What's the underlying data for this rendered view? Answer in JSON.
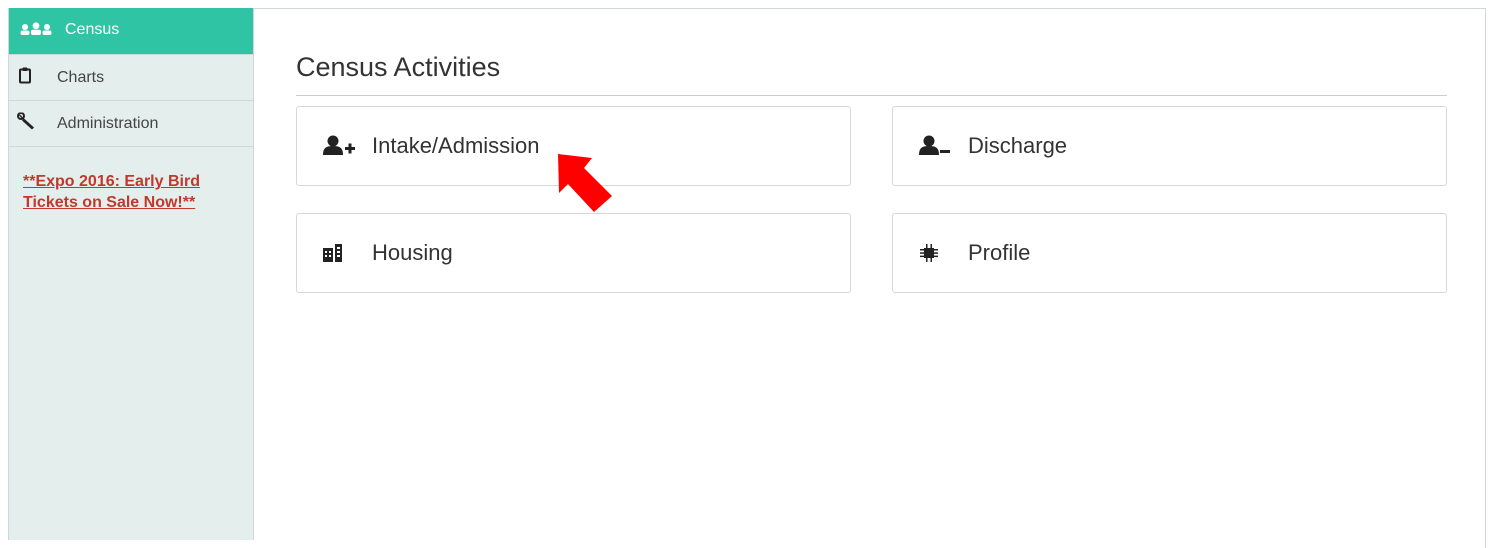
{
  "sidebar": {
    "items": [
      {
        "label": "Census",
        "icon": "users-icon",
        "active": true
      },
      {
        "label": "Charts",
        "icon": "clipboard-icon",
        "active": false
      },
      {
        "label": "Administration",
        "icon": "wrench-icon",
        "active": false
      }
    ],
    "promo": "**Expo 2016: Early Bird Tickets on Sale Now!**"
  },
  "main": {
    "title": "Census Activities",
    "cards": [
      {
        "label": "Intake/Admission",
        "icon": "user-plus-icon"
      },
      {
        "label": "Discharge",
        "icon": "user-minus-icon"
      },
      {
        "label": "Housing",
        "icon": "building-icon"
      },
      {
        "label": "Profile",
        "icon": "chip-icon"
      }
    ]
  },
  "colors": {
    "accent": "#2fc4a4",
    "sidebar_bg": "#e4eeec",
    "promo_link": "#c0392b",
    "annotation_arrow": "#ff0000"
  }
}
